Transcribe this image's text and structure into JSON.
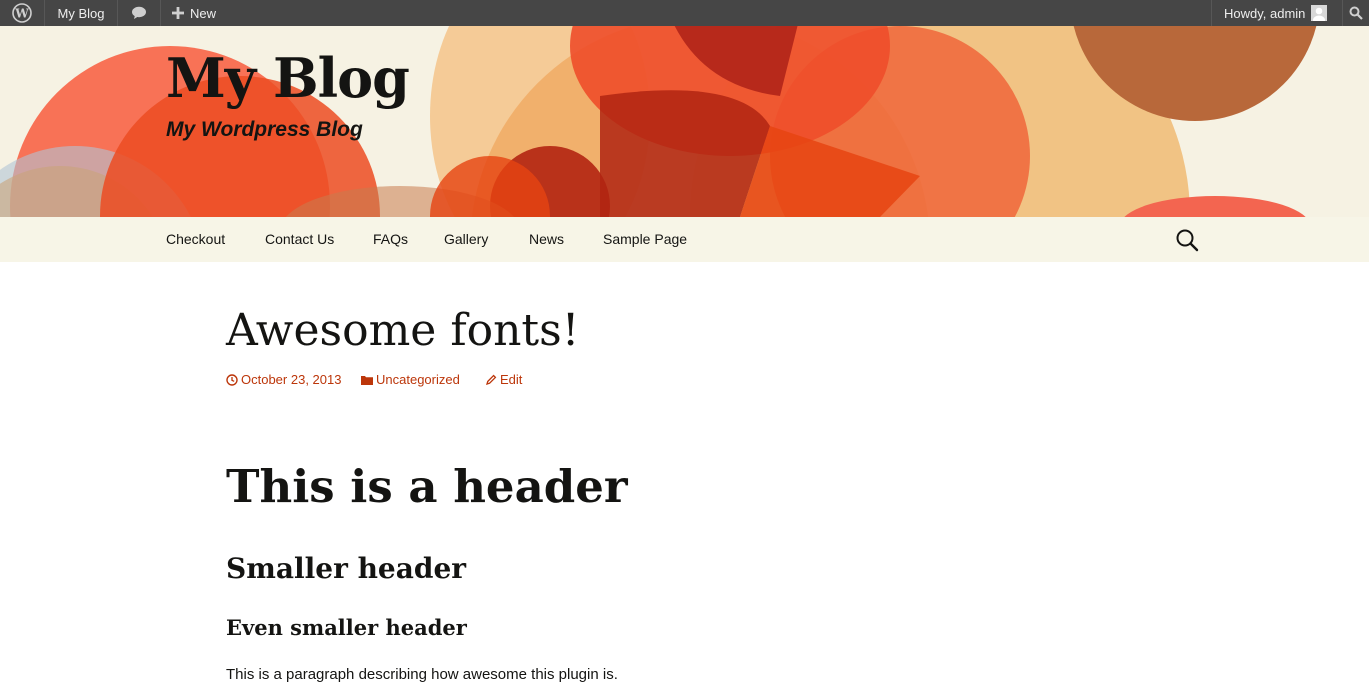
{
  "admin_bar": {
    "wp_logo_icon": "wordpress-logo-icon",
    "site_name": "My Blog",
    "comments_icon": "comment-bubble-icon",
    "new_label": "New",
    "new_icon": "plus-icon",
    "howdy": "Howdy, admin",
    "avatar_icon": "user-avatar-icon",
    "search_icon": "search-icon"
  },
  "header": {
    "site_title": "My Blog",
    "site_description": "My Wordpress Blog"
  },
  "nav": {
    "items": [
      "Checkout",
      "Contact Us",
      "FAQs",
      "Gallery",
      "News",
      "Sample Page"
    ],
    "search_icon": "search-icon"
  },
  "post": {
    "title": "Awesome fonts!",
    "meta": {
      "date": "October 23, 2013",
      "category": "Uncategorized",
      "edit": "Edit"
    },
    "content": {
      "h1": "This is a header",
      "h2": "Smaller header",
      "h3": "Even smaller header",
      "paragraph": "This is a paragraph describing how awesome this plugin is."
    }
  },
  "colors": {
    "admin_bar_bg": "#464646",
    "header_bg": "#f6f2e3",
    "nav_bg": "#f7f5e7",
    "link_accent": "#bc360a",
    "text": "#141412"
  }
}
